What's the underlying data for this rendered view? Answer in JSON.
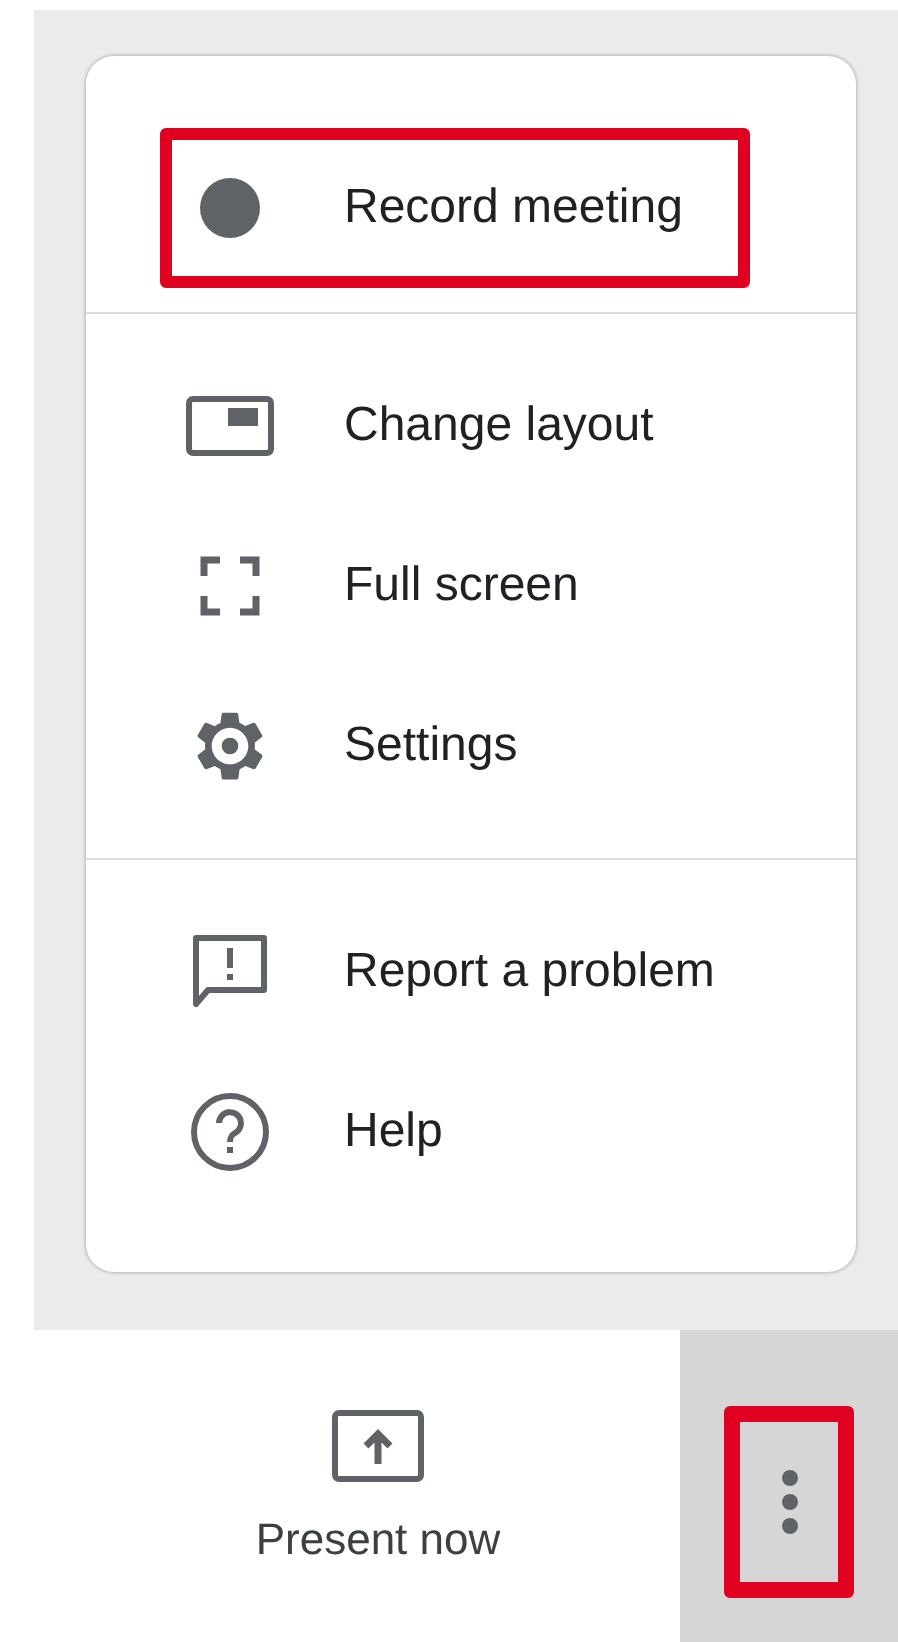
{
  "menu": {
    "sections": [
      {
        "items": [
          {
            "kind": "record",
            "label": "Record meeting",
            "highlighted": true
          }
        ]
      },
      {
        "items": [
          {
            "kind": "layout",
            "label": "Change layout",
            "highlighted": false
          },
          {
            "kind": "fullscreen",
            "label": "Full screen",
            "highlighted": false
          },
          {
            "kind": "settings",
            "label": "Settings",
            "highlighted": false
          }
        ]
      },
      {
        "items": [
          {
            "kind": "report",
            "label": "Report a problem",
            "highlighted": false
          },
          {
            "kind": "help",
            "label": "Help",
            "highlighted": false
          }
        ]
      }
    ]
  },
  "toolbar": {
    "present_button": {
      "label": "Present now"
    },
    "more_button": {
      "highlighted": true
    }
  }
}
